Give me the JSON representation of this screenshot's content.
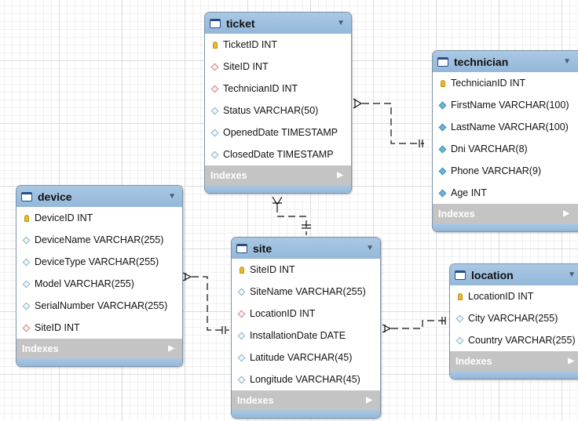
{
  "indexes_label": "Indexes",
  "colors": {
    "header": "#9cbfde",
    "indexes_bar": "#c4c4c4",
    "primary_key": "#e8b92c",
    "foreign_key": "#c98a8a",
    "not_null": "#3e8fb8",
    "column": "#8db3c9"
  },
  "tables": {
    "ticket": {
      "name": "ticket",
      "columns": [
        {
          "text": "TicketID INT",
          "icon": "key-icon"
        },
        {
          "text": "SiteID INT",
          "icon": "foreign-key-diamond-icon"
        },
        {
          "text": "TechnicianID INT",
          "icon": "foreign-key-diamond-icon"
        },
        {
          "text": "Status VARCHAR(50)",
          "icon": "column-diamond-icon"
        },
        {
          "text": "OpenedDate TIMESTAMP",
          "icon": "column-diamond-icon"
        },
        {
          "text": "ClosedDate TIMESTAMP",
          "icon": "column-diamond-icon"
        }
      ]
    },
    "technician": {
      "name": "technician",
      "columns": [
        {
          "text": "TechnicianID INT",
          "icon": "key-icon"
        },
        {
          "text": "FirstName VARCHAR(100)",
          "icon": "not-null-diamond-icon"
        },
        {
          "text": "LastName VARCHAR(100)",
          "icon": "not-null-diamond-icon"
        },
        {
          "text": "Dni VARCHAR(8)",
          "icon": "not-null-diamond-icon"
        },
        {
          "text": "Phone VARCHAR(9)",
          "icon": "not-null-diamond-icon"
        },
        {
          "text": "Age INT",
          "icon": "not-null-diamond-icon"
        }
      ]
    },
    "device": {
      "name": "device",
      "columns": [
        {
          "text": "DeviceID INT",
          "icon": "key-icon"
        },
        {
          "text": "DeviceName VARCHAR(255)",
          "icon": "column-diamond-icon"
        },
        {
          "text": "DeviceType VARCHAR(255)",
          "icon": "column-diamond-icon"
        },
        {
          "text": "Model VARCHAR(255)",
          "icon": "column-diamond-icon"
        },
        {
          "text": "SerialNumber VARCHAR(255)",
          "icon": "column-diamond-icon"
        },
        {
          "text": "SiteID INT",
          "icon": "foreign-key-diamond-icon"
        }
      ]
    },
    "site": {
      "name": "site",
      "columns": [
        {
          "text": "SiteID INT",
          "icon": "key-icon"
        },
        {
          "text": "SiteName VARCHAR(255)",
          "icon": "column-diamond-icon"
        },
        {
          "text": "LocationID INT",
          "icon": "foreign-key-diamond-icon"
        },
        {
          "text": "InstallationDate DATE",
          "icon": "column-diamond-icon"
        },
        {
          "text": "Latitude VARCHAR(45)",
          "icon": "column-diamond-icon"
        },
        {
          "text": "Longitude VARCHAR(45)",
          "icon": "column-diamond-icon"
        }
      ]
    },
    "location": {
      "name": "location",
      "columns": [
        {
          "text": "LocationID INT",
          "icon": "key-icon"
        },
        {
          "text": "City VARCHAR(255)",
          "icon": "column-diamond-icon"
        },
        {
          "text": "Country VARCHAR(255)",
          "icon": "column-diamond-icon"
        }
      ]
    }
  }
}
